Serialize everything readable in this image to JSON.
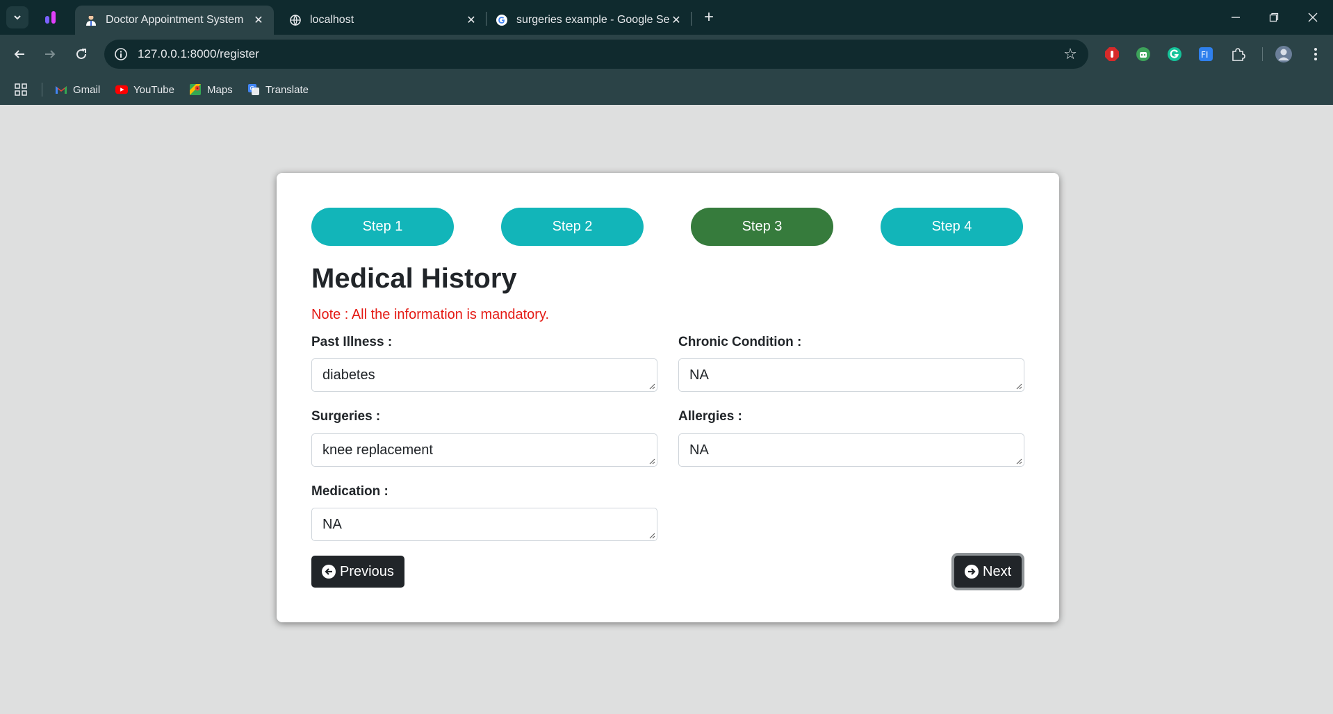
{
  "browser": {
    "tabs": [
      {
        "title": "Doctor Appointment System",
        "icon": "doctor-icon",
        "active": true
      },
      {
        "title": "localhost",
        "icon": "globe-icon",
        "active": false
      },
      {
        "title": "surgeries example - Google Sea",
        "icon": "google-icon",
        "active": false
      }
    ],
    "address": "127.0.0.1:8000/register",
    "bookmarks": [
      {
        "label": "Gmail",
        "icon": "gmail-icon"
      },
      {
        "label": "YouTube",
        "icon": "youtube-icon"
      },
      {
        "label": "Maps",
        "icon": "maps-icon"
      },
      {
        "label": "Translate",
        "icon": "translate-icon"
      }
    ],
    "colors": {
      "tabbar": "#0f2a2e",
      "toolbar": "#2b4347"
    }
  },
  "steps": [
    {
      "label": "Step 1",
      "current": false
    },
    {
      "label": "Step 2",
      "current": false
    },
    {
      "label": "Step 3",
      "current": true
    },
    {
      "label": "Step 4",
      "current": false
    }
  ],
  "form": {
    "title": "Medical History",
    "note": "Note : All the information is mandatory.",
    "fields": {
      "past_illness": {
        "label": "Past Illness :",
        "value": "diabetes"
      },
      "chronic_condition": {
        "label": "Chronic Condition :",
        "value": "NA"
      },
      "surgeries": {
        "label": "Surgeries :",
        "value": "knee replacement"
      },
      "allergies": {
        "label": "Allergies :",
        "value": "NA"
      },
      "medication": {
        "label": "Medication :",
        "value": "NA"
      }
    },
    "previous_label": "Previous",
    "next_label": "Next"
  },
  "colors": {
    "step_default": "#12b5b9",
    "step_current": "#367b3c",
    "note": "#e41a14",
    "button_dark": "#212529",
    "page_bg": "#dedfdf"
  }
}
